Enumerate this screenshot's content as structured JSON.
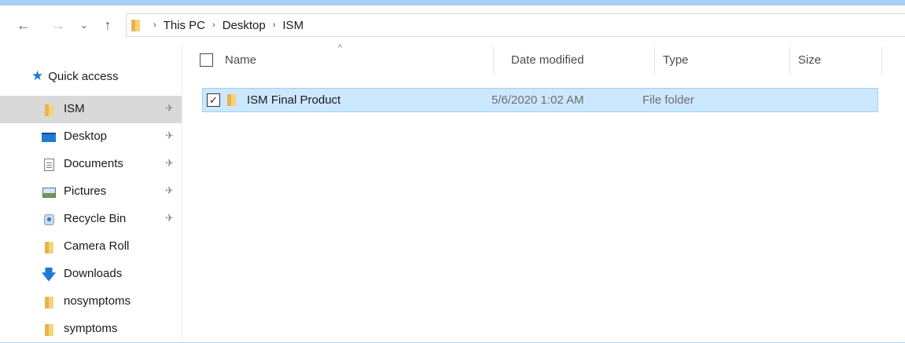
{
  "nav": {
    "back_icon": "←",
    "forward_icon": "→",
    "recent_icon": "⌄",
    "up_icon": "↑",
    "breadcrumb": [
      "This PC",
      "Desktop",
      "ISM"
    ],
    "separator": "›"
  },
  "sidebar": {
    "quick_access_label": "Quick access",
    "items": [
      {
        "label": "ISM",
        "icon": "folder-icon",
        "pinned": true,
        "selected": true
      },
      {
        "label": "Desktop",
        "icon": "desktop-icon",
        "pinned": true
      },
      {
        "label": "Documents",
        "icon": "documents-icon",
        "pinned": true
      },
      {
        "label": "Pictures",
        "icon": "pictures-icon",
        "pinned": true
      },
      {
        "label": "Recycle Bin",
        "icon": "recycle-bin-icon",
        "pinned": true
      },
      {
        "label": "Camera Roll",
        "icon": "folder-icon",
        "pinned": false
      },
      {
        "label": "Downloads",
        "icon": "download-icon",
        "pinned": false
      },
      {
        "label": "nosymptoms",
        "icon": "folder-icon",
        "pinned": false
      },
      {
        "label": "symptoms",
        "icon": "folder-icon",
        "pinned": false
      }
    ],
    "pin_glyph": "📌"
  },
  "columns": {
    "name": "Name",
    "date_modified": "Date modified",
    "type": "Type",
    "size": "Size",
    "sort_caret": "^"
  },
  "files": [
    {
      "name": "ISM Final Product",
      "date_modified": "5/6/2020 1:02 AM",
      "type": "File folder",
      "size": "",
      "checked": true
    }
  ],
  "colors": {
    "background": "#a9d0f5",
    "selection": "#cce8ff",
    "selection_border": "#99d1ff",
    "sidebar_selected": "#d9d9d9",
    "accent": "#1e7ad6"
  }
}
